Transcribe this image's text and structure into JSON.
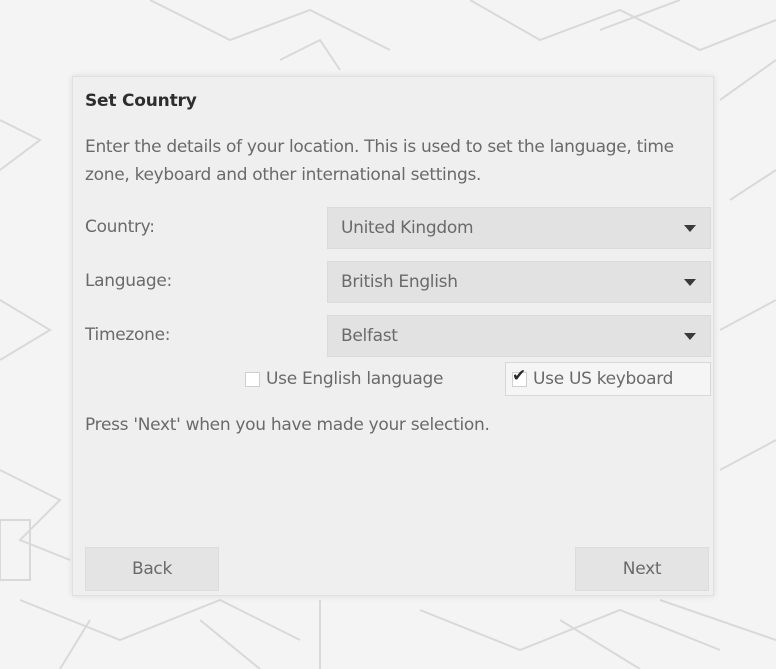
{
  "dialog": {
    "title": "Set Country",
    "description": "Enter the details of your location. This is used to set the language, time zone, keyboard and other international settings.",
    "country": {
      "label": "Country:",
      "value": "United Kingdom"
    },
    "language": {
      "label": "Language:",
      "value": "British English"
    },
    "timezone": {
      "label": "Timezone:",
      "value": "Belfast"
    },
    "use_english": {
      "label": "Use English language",
      "checked": false
    },
    "use_us_keyboard": {
      "label": "Use US keyboard",
      "checked": true,
      "check_glyph": "✔"
    },
    "press_next": "Press 'Next' when you have made your selection.",
    "back_label": "Back",
    "next_label": "Next"
  },
  "icons": {
    "dropdown": "chevron-down-icon",
    "check": "checkmark-icon"
  },
  "colors": {
    "dialog_bg": "#efefef",
    "combo_bg": "#e2e2e2",
    "text": "#6a6a6a",
    "title": "#2e2e2e"
  }
}
